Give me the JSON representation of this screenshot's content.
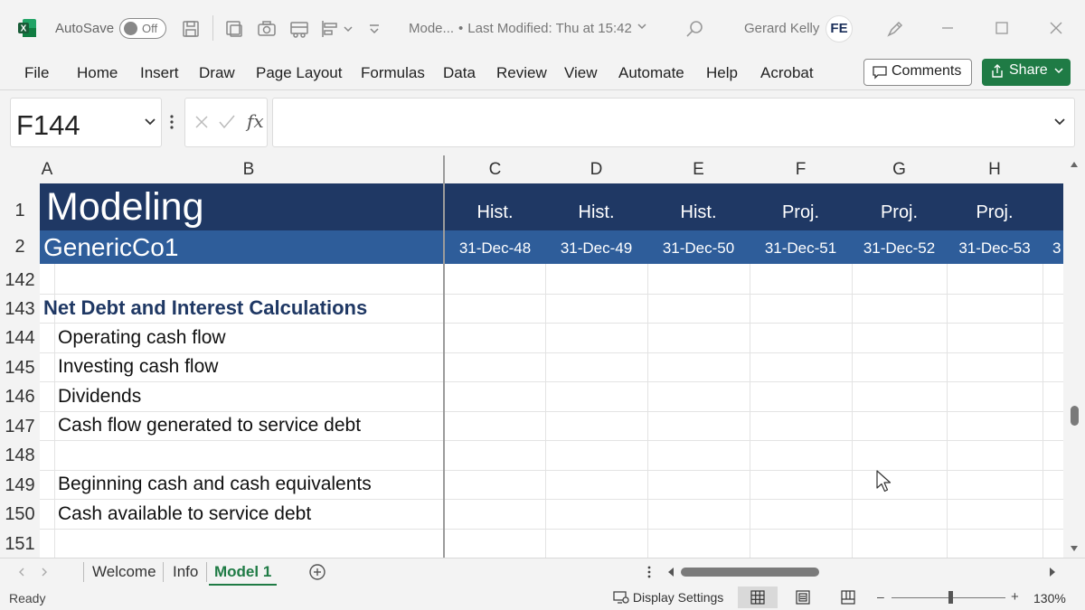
{
  "titlebar": {
    "app_icon": "excel-logo-icon",
    "app_letter": "X",
    "autosave_label": "AutoSave",
    "autosave_state": "Off",
    "doc_name": "Mode...",
    "last_modified": "Last Modified: Thu at 15:42",
    "user_name": "Gerard Kelly",
    "user_initials": "FE"
  },
  "ribbon": {
    "tabs": [
      "File",
      "Home",
      "Insert",
      "Draw",
      "Page Layout",
      "Formulas",
      "Data",
      "Review",
      "View",
      "Automate",
      "Help",
      "Acrobat"
    ],
    "comments_label": "Comments",
    "share_label": "Share"
  },
  "formula_bar": {
    "name_box": "F144",
    "fx_label": "fx",
    "formula": ""
  },
  "grid": {
    "column_headers": [
      "A",
      "B",
      "C",
      "D",
      "E",
      "F",
      "G",
      "H"
    ],
    "header_rows": [
      "1",
      "2"
    ],
    "title": "Modeling",
    "company": "GenericCo1",
    "period_types": [
      "Hist.",
      "Hist.",
      "Hist.",
      "Proj.",
      "Proj.",
      "Proj."
    ],
    "period_dates": [
      "31-Dec-48",
      "31-Dec-49",
      "31-Dec-50",
      "31-Dec-51",
      "31-Dec-52",
      "31-Dec-53"
    ],
    "overflow_date_fragment": "3",
    "rows": [
      {
        "num": "142",
        "label": ""
      },
      {
        "num": "143",
        "label": "Net Debt and Interest Calculations"
      },
      {
        "num": "144",
        "label": "Operating cash flow"
      },
      {
        "num": "145",
        "label": "Investing cash flow"
      },
      {
        "num": "146",
        "label": "Dividends"
      },
      {
        "num": "147",
        "label": "Cash flow generated to service debt"
      },
      {
        "num": "148",
        "label": ""
      },
      {
        "num": "149",
        "label": "Beginning cash and cash equivalents"
      },
      {
        "num": "150",
        "label": "Cash available to service debt"
      },
      {
        "num": "151",
        "label": ""
      }
    ]
  },
  "sheets": {
    "tabs": [
      "Welcome",
      "Info",
      "Model 1"
    ],
    "active": "Model 1"
  },
  "statusbar": {
    "ready": "Ready",
    "display_settings": "Display Settings",
    "zoom_minus": "–",
    "zoom_plus": "+",
    "zoom": "130%",
    "zoom_fraction": 0.52
  },
  "colors": {
    "excel_green": "#1f7b45",
    "header_navy": "#1f3864",
    "header_blue": "#2e5d9a"
  }
}
